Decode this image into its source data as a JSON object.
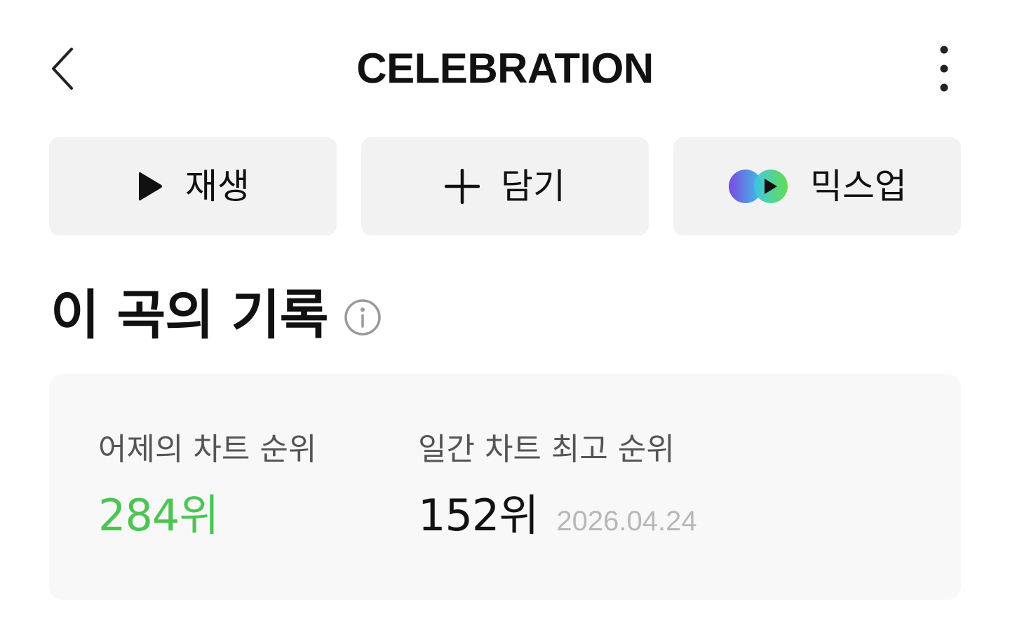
{
  "header": {
    "title": "CELEBRATION",
    "back_icon": "chevron-left-icon",
    "more_icon": "more-vertical-icon"
  },
  "actions": [
    {
      "label": "재생",
      "icon": "play-icon"
    },
    {
      "label": "담기",
      "icon": "plus-icon"
    },
    {
      "label": "믹스업",
      "icon": "mixup-icon"
    }
  ],
  "section": {
    "title": "이 곡의 기록",
    "info_icon": "info-icon"
  },
  "records": {
    "yesterday": {
      "label": "어제의 차트 순위",
      "value": "284위"
    },
    "best": {
      "label": "일간 차트 최고 순위",
      "value": "152위",
      "date": "2026.04.24"
    }
  },
  "colors": {
    "accent_green": "#4cc552",
    "button_bg": "#f2f2f2",
    "card_bg": "#f8f8f8",
    "mixup_gradient": [
      "#7b4ae2",
      "#3cc4e6",
      "#5adb4a"
    ]
  }
}
